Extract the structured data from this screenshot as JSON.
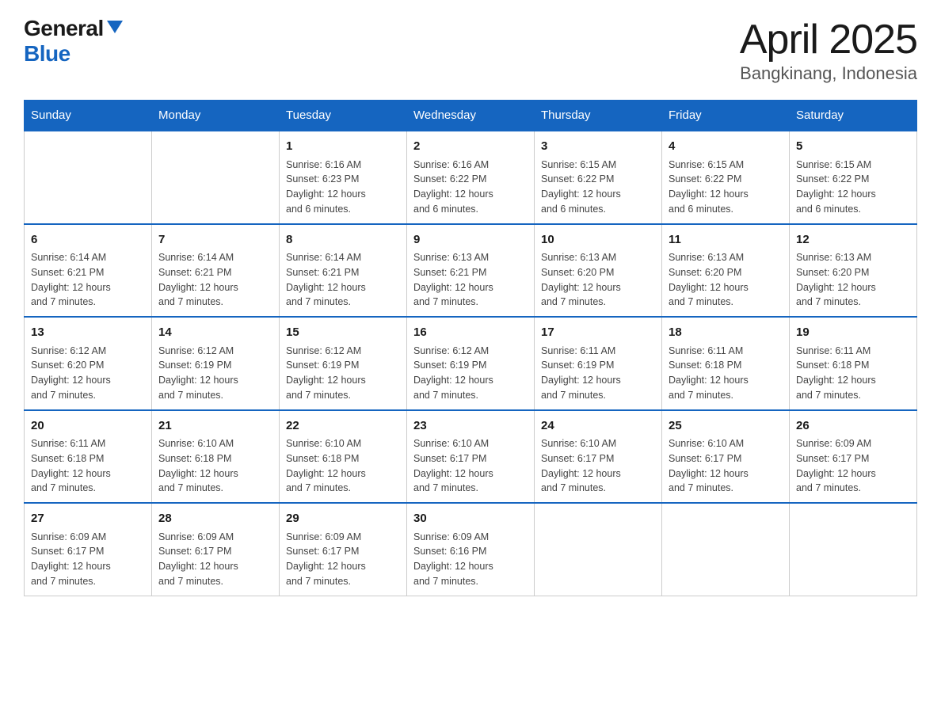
{
  "header": {
    "logo_general": "General",
    "logo_blue": "Blue",
    "title": "April 2025",
    "subtitle": "Bangkinang, Indonesia"
  },
  "days_of_week": [
    "Sunday",
    "Monday",
    "Tuesday",
    "Wednesday",
    "Thursday",
    "Friday",
    "Saturday"
  ],
  "weeks": [
    {
      "days": [
        {
          "number": "",
          "info": ""
        },
        {
          "number": "",
          "info": ""
        },
        {
          "number": "1",
          "info": "Sunrise: 6:16 AM\nSunset: 6:23 PM\nDaylight: 12 hours\nand 6 minutes."
        },
        {
          "number": "2",
          "info": "Sunrise: 6:16 AM\nSunset: 6:22 PM\nDaylight: 12 hours\nand 6 minutes."
        },
        {
          "number": "3",
          "info": "Sunrise: 6:15 AM\nSunset: 6:22 PM\nDaylight: 12 hours\nand 6 minutes."
        },
        {
          "number": "4",
          "info": "Sunrise: 6:15 AM\nSunset: 6:22 PM\nDaylight: 12 hours\nand 6 minutes."
        },
        {
          "number": "5",
          "info": "Sunrise: 6:15 AM\nSunset: 6:22 PM\nDaylight: 12 hours\nand 6 minutes."
        }
      ]
    },
    {
      "days": [
        {
          "number": "6",
          "info": "Sunrise: 6:14 AM\nSunset: 6:21 PM\nDaylight: 12 hours\nand 7 minutes."
        },
        {
          "number": "7",
          "info": "Sunrise: 6:14 AM\nSunset: 6:21 PM\nDaylight: 12 hours\nand 7 minutes."
        },
        {
          "number": "8",
          "info": "Sunrise: 6:14 AM\nSunset: 6:21 PM\nDaylight: 12 hours\nand 7 minutes."
        },
        {
          "number": "9",
          "info": "Sunrise: 6:13 AM\nSunset: 6:21 PM\nDaylight: 12 hours\nand 7 minutes."
        },
        {
          "number": "10",
          "info": "Sunrise: 6:13 AM\nSunset: 6:20 PM\nDaylight: 12 hours\nand 7 minutes."
        },
        {
          "number": "11",
          "info": "Sunrise: 6:13 AM\nSunset: 6:20 PM\nDaylight: 12 hours\nand 7 minutes."
        },
        {
          "number": "12",
          "info": "Sunrise: 6:13 AM\nSunset: 6:20 PM\nDaylight: 12 hours\nand 7 minutes."
        }
      ]
    },
    {
      "days": [
        {
          "number": "13",
          "info": "Sunrise: 6:12 AM\nSunset: 6:20 PM\nDaylight: 12 hours\nand 7 minutes."
        },
        {
          "number": "14",
          "info": "Sunrise: 6:12 AM\nSunset: 6:19 PM\nDaylight: 12 hours\nand 7 minutes."
        },
        {
          "number": "15",
          "info": "Sunrise: 6:12 AM\nSunset: 6:19 PM\nDaylight: 12 hours\nand 7 minutes."
        },
        {
          "number": "16",
          "info": "Sunrise: 6:12 AM\nSunset: 6:19 PM\nDaylight: 12 hours\nand 7 minutes."
        },
        {
          "number": "17",
          "info": "Sunrise: 6:11 AM\nSunset: 6:19 PM\nDaylight: 12 hours\nand 7 minutes."
        },
        {
          "number": "18",
          "info": "Sunrise: 6:11 AM\nSunset: 6:18 PM\nDaylight: 12 hours\nand 7 minutes."
        },
        {
          "number": "19",
          "info": "Sunrise: 6:11 AM\nSunset: 6:18 PM\nDaylight: 12 hours\nand 7 minutes."
        }
      ]
    },
    {
      "days": [
        {
          "number": "20",
          "info": "Sunrise: 6:11 AM\nSunset: 6:18 PM\nDaylight: 12 hours\nand 7 minutes."
        },
        {
          "number": "21",
          "info": "Sunrise: 6:10 AM\nSunset: 6:18 PM\nDaylight: 12 hours\nand 7 minutes."
        },
        {
          "number": "22",
          "info": "Sunrise: 6:10 AM\nSunset: 6:18 PM\nDaylight: 12 hours\nand 7 minutes."
        },
        {
          "number": "23",
          "info": "Sunrise: 6:10 AM\nSunset: 6:17 PM\nDaylight: 12 hours\nand 7 minutes."
        },
        {
          "number": "24",
          "info": "Sunrise: 6:10 AM\nSunset: 6:17 PM\nDaylight: 12 hours\nand 7 minutes."
        },
        {
          "number": "25",
          "info": "Sunrise: 6:10 AM\nSunset: 6:17 PM\nDaylight: 12 hours\nand 7 minutes."
        },
        {
          "number": "26",
          "info": "Sunrise: 6:09 AM\nSunset: 6:17 PM\nDaylight: 12 hours\nand 7 minutes."
        }
      ]
    },
    {
      "days": [
        {
          "number": "27",
          "info": "Sunrise: 6:09 AM\nSunset: 6:17 PM\nDaylight: 12 hours\nand 7 minutes."
        },
        {
          "number": "28",
          "info": "Sunrise: 6:09 AM\nSunset: 6:17 PM\nDaylight: 12 hours\nand 7 minutes."
        },
        {
          "number": "29",
          "info": "Sunrise: 6:09 AM\nSunset: 6:17 PM\nDaylight: 12 hours\nand 7 minutes."
        },
        {
          "number": "30",
          "info": "Sunrise: 6:09 AM\nSunset: 6:16 PM\nDaylight: 12 hours\nand 7 minutes."
        },
        {
          "number": "",
          "info": ""
        },
        {
          "number": "",
          "info": ""
        },
        {
          "number": "",
          "info": ""
        }
      ]
    }
  ]
}
